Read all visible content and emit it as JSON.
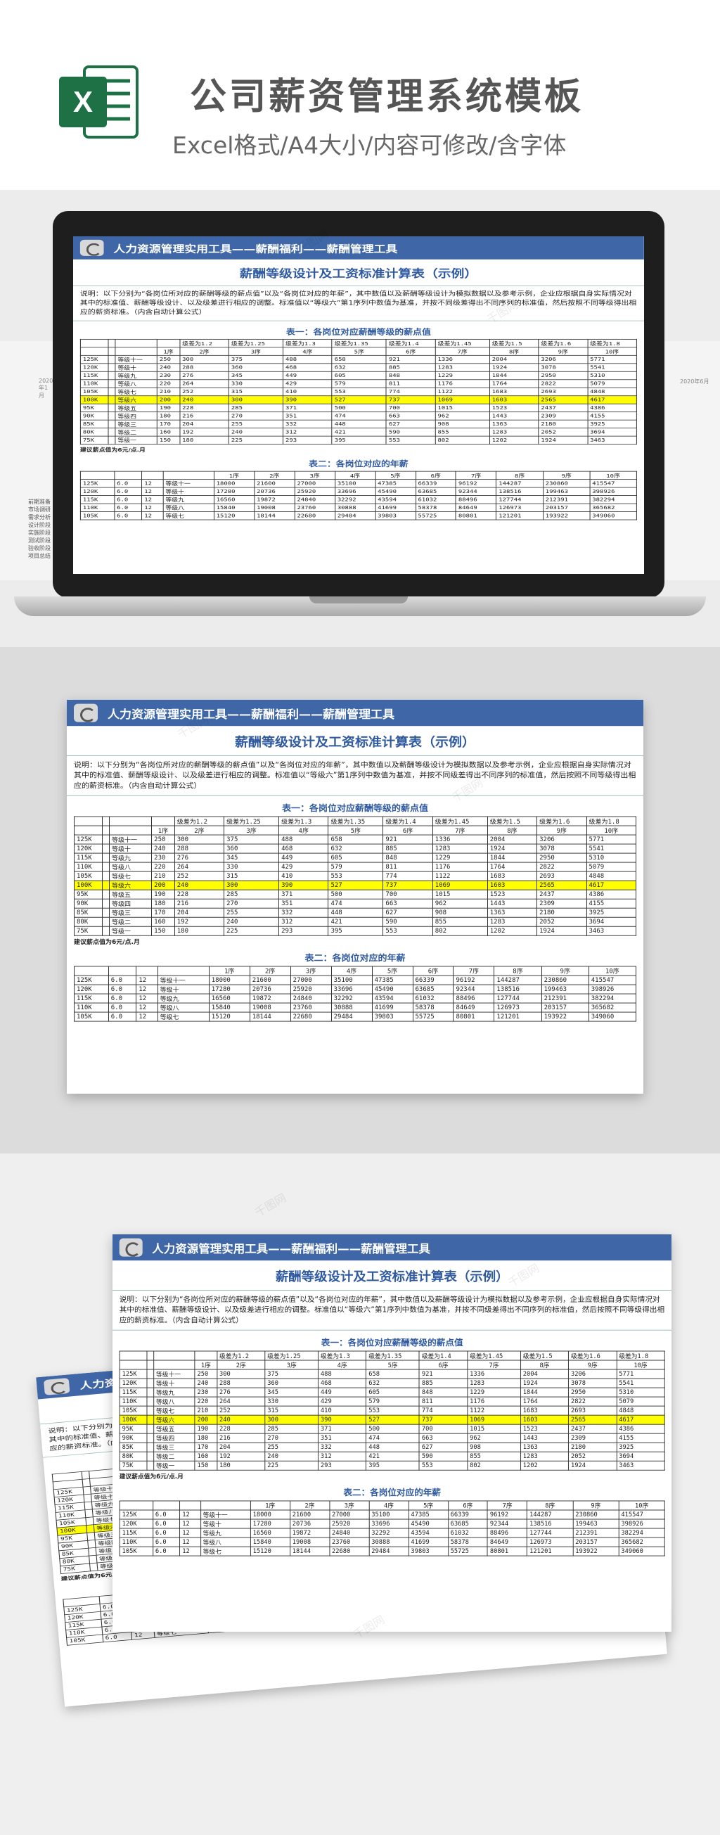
{
  "header": {
    "title": "公司薪资管理系统模板",
    "subtitle": "Excel格式/A4大小/内容可修改/含字体",
    "logo_letter": "X"
  },
  "sheet": {
    "toolbar_text": "人力资源管理实用工具——薪酬福利——薪酬管理工具",
    "title": "薪酬等级设计及工资标准计算表（示例）",
    "description": "说明：以下分别为“各岗位所对应的薪酬等级的薪点值”以及“各岗位对应的年薪”，其中数值以及薪酬等级设计为模拟数据以及参考示例，企业应根据自身实际情况对其中的标准值、薪酬等级设计、以及级差进行相应的调整。标准值以“等级六”第1序列中数值为基准，并按不同级差得出不同序列的标准值，然后按照不同等级得出相应的薪资标准。（内含自动计算公式）",
    "table1_caption": "表一：各岗位对应薪酬等级的薪点值",
    "table1_diff_headers": [
      "级差为1.2",
      "级差为1.25",
      "级差为1.3",
      "级差为1.35",
      "级差为1.4",
      "级差为1.45",
      "级差为1.5",
      "级差为1.6",
      "级差为1.8"
    ],
    "seq_headers": [
      "1序",
      "2序",
      "3序",
      "4序",
      "5序",
      "6序",
      "7序",
      "8序",
      "9序",
      "10序"
    ],
    "table1_rows": [
      {
        "k": "125K",
        "g": "等级十一",
        "v": [
          "250",
          "300",
          "375",
          "488",
          "658",
          "921",
          "1336",
          "2004",
          "3206",
          "5771"
        ]
      },
      {
        "k": "120K",
        "g": "等级十",
        "v": [
          "240",
          "288",
          "360",
          "468",
          "632",
          "885",
          "1283",
          "1924",
          "3078",
          "5541"
        ]
      },
      {
        "k": "115K",
        "g": "等级九",
        "v": [
          "230",
          "276",
          "345",
          "449",
          "605",
          "848",
          "1229",
          "1844",
          "2950",
          "5310"
        ]
      },
      {
        "k": "110K",
        "g": "等级八",
        "v": [
          "220",
          "264",
          "330",
          "429",
          "579",
          "811",
          "1176",
          "1764",
          "2822",
          "5079"
        ]
      },
      {
        "k": "105K",
        "g": "等级七",
        "v": [
          "210",
          "252",
          "315",
          "410",
          "553",
          "774",
          "1122",
          "1683",
          "2693",
          "4848"
        ]
      },
      {
        "k": "100K",
        "g": "等级六",
        "v": [
          "200",
          "240",
          "300",
          "390",
          "527",
          "737",
          "1069",
          "1603",
          "2565",
          "4617"
        ],
        "hl": true
      },
      {
        "k": "95K",
        "g": "等级五",
        "v": [
          "190",
          "228",
          "285",
          "371",
          "500",
          "700",
          "1015",
          "1523",
          "2437",
          "4386"
        ]
      },
      {
        "k": "90K",
        "g": "等级四",
        "v": [
          "180",
          "216",
          "270",
          "351",
          "474",
          "663",
          "962",
          "1443",
          "2309",
          "4155"
        ]
      },
      {
        "k": "85K",
        "g": "等级三",
        "v": [
          "170",
          "204",
          "255",
          "332",
          "448",
          "627",
          "908",
          "1363",
          "2180",
          "3925"
        ]
      },
      {
        "k": "80K",
        "g": "等级二",
        "v": [
          "160",
          "192",
          "240",
          "312",
          "421",
          "590",
          "855",
          "1283",
          "2052",
          "3694"
        ]
      },
      {
        "k": "75K",
        "g": "等级一",
        "v": [
          "150",
          "180",
          "225",
          "293",
          "395",
          "553",
          "802",
          "1202",
          "1924",
          "3463"
        ]
      }
    ],
    "table1_note": "建议薪点值为6元/点.月",
    "table2_caption": "表二：各岗位对应的年薪",
    "table2_rows": [
      {
        "k": "125K",
        "a": "6.0",
        "b": "12",
        "g": "等级十一",
        "v": [
          "18000",
          "21600",
          "27000",
          "35100",
          "47385",
          "66339",
          "96192",
          "144287",
          "230860",
          "415547"
        ]
      },
      {
        "k": "120K",
        "a": "6.0",
        "b": "12",
        "g": "等级十",
        "v": [
          "17280",
          "20736",
          "25920",
          "33696",
          "45490",
          "63685",
          "92344",
          "138516",
          "199463",
          "398926"
        ]
      },
      {
        "k": "115K",
        "a": "6.0",
        "b": "12",
        "g": "等级九",
        "v": [
          "16560",
          "19872",
          "24840",
          "32292",
          "43594",
          "61032",
          "88496",
          "127744",
          "212391",
          "382294"
        ]
      },
      {
        "k": "110K",
        "a": "6.0",
        "b": "12",
        "g": "等级八",
        "v": [
          "15840",
          "19008",
          "23760",
          "30888",
          "41699",
          "58378",
          "84649",
          "126973",
          "203157",
          "365682"
        ]
      },
      {
        "k": "105K",
        "a": "6.0",
        "b": "12",
        "g": "等级七",
        "v": [
          "15120",
          "18144",
          "22680",
          "29484",
          "39803",
          "55725",
          "80801",
          "121201",
          "193922",
          "349060"
        ]
      }
    ]
  },
  "gantt_labels": {
    "left_caption": "2020年1月",
    "left_items": [
      "前期准备",
      "市场调研",
      "需求分析",
      "设计阶段",
      "实施阶段",
      "测试阶段",
      "验收阶段",
      "项目总结"
    ],
    "right_caption": "2020年6月"
  },
  "watermark": "千图网",
  "colors": {
    "band": "#3f67a7",
    "title": "#2f5aa0",
    "highlight": "#ffff00",
    "excel_green": "#1e7145"
  }
}
